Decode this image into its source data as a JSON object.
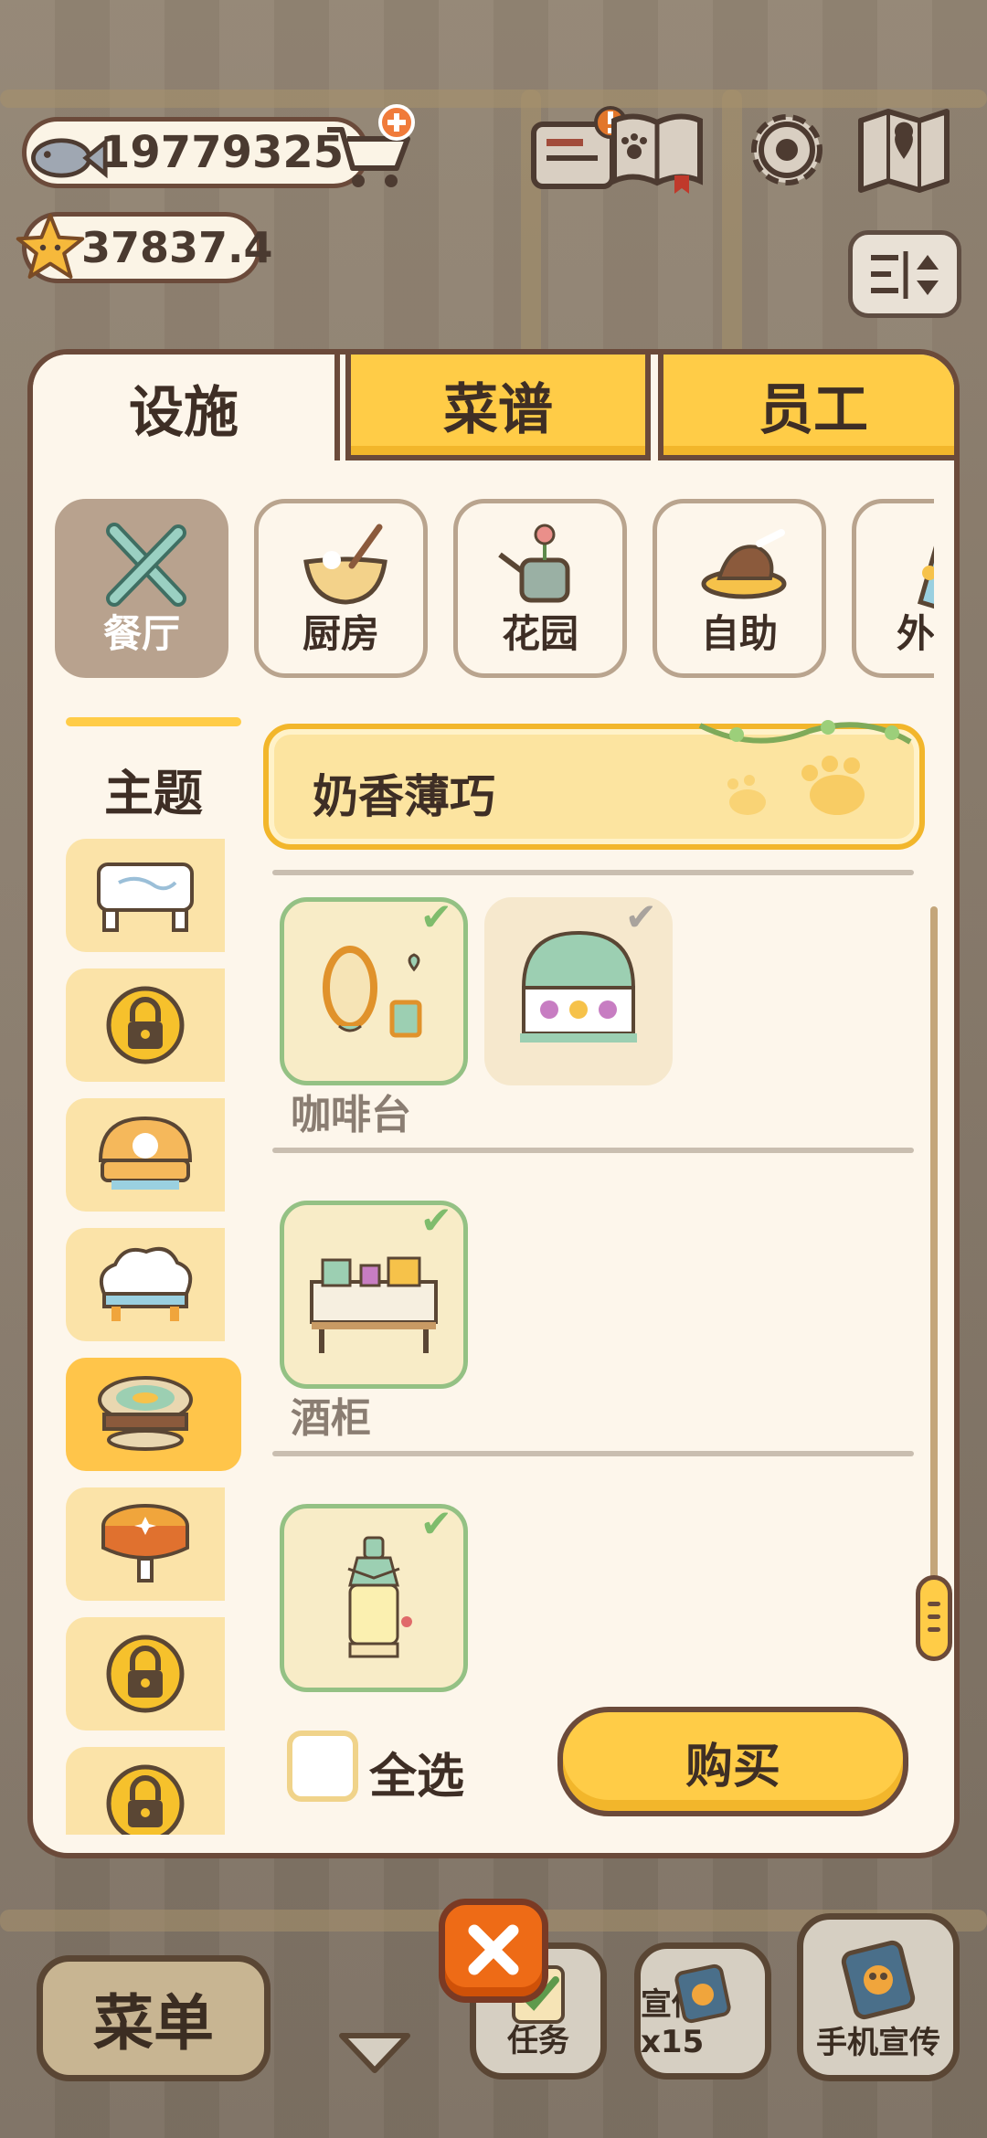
{
  "currency": {
    "fish": "19779325",
    "stars": "37837.4"
  },
  "tabs": [
    {
      "label": "设施",
      "active": true
    },
    {
      "label": "菜谱",
      "active": false
    },
    {
      "label": "员工",
      "active": false
    }
  ],
  "categories": [
    {
      "label": "餐厅",
      "icon": "utensils-icon",
      "active": true
    },
    {
      "label": "厨房",
      "icon": "mixing-bowl-icon",
      "active": false
    },
    {
      "label": "花园",
      "icon": "watering-can-icon",
      "active": false
    },
    {
      "label": "自助",
      "icon": "buffet-icon",
      "active": false
    },
    {
      "label": "外",
      "icon": "outdoor-icon",
      "active": false
    }
  ],
  "theme": {
    "heading": "主题",
    "selected_name": "奶香薄巧",
    "items": [
      {
        "icon": "marble-table-icon",
        "locked": false
      },
      {
        "icon": "lock-icon",
        "locked": true
      },
      {
        "icon": "bread-table-icon",
        "locked": false
      },
      {
        "icon": "cloud-table-icon",
        "locked": false
      },
      {
        "icon": "mint-cake-table-icon",
        "locked": false,
        "selected": true
      },
      {
        "icon": "orange-round-table-icon",
        "locked": false
      },
      {
        "icon": "lock-icon",
        "locked": true
      },
      {
        "icon": "lock-icon",
        "locked": true
      }
    ]
  },
  "sections": [
    {
      "label": "",
      "items": [
        {
          "icon": "mirror-decor-icon",
          "owned": true
        },
        {
          "icon": "dessert-counter-icon",
          "owned": true
        }
      ]
    },
    {
      "label": "咖啡台",
      "items": [
        {
          "icon": "coffee-bar-icon",
          "owned": true
        }
      ]
    },
    {
      "label": "酒柜",
      "items": [
        {
          "icon": "bottle-cabinet-icon",
          "owned": true
        }
      ]
    }
  ],
  "controls": {
    "select_all": "全选",
    "buy": "购买"
  },
  "bottom_bar": {
    "menu": "菜单",
    "tasks": "任务",
    "promote": "宣传x15",
    "phone_promote": "手机宣传"
  },
  "colors": {
    "accent_yellow": "#ffcc47",
    "panel_bg": "#fdf6eb",
    "border_brown": "#6b4a3a",
    "owned_green": "#94c184",
    "close_orange": "#ee6b16"
  }
}
